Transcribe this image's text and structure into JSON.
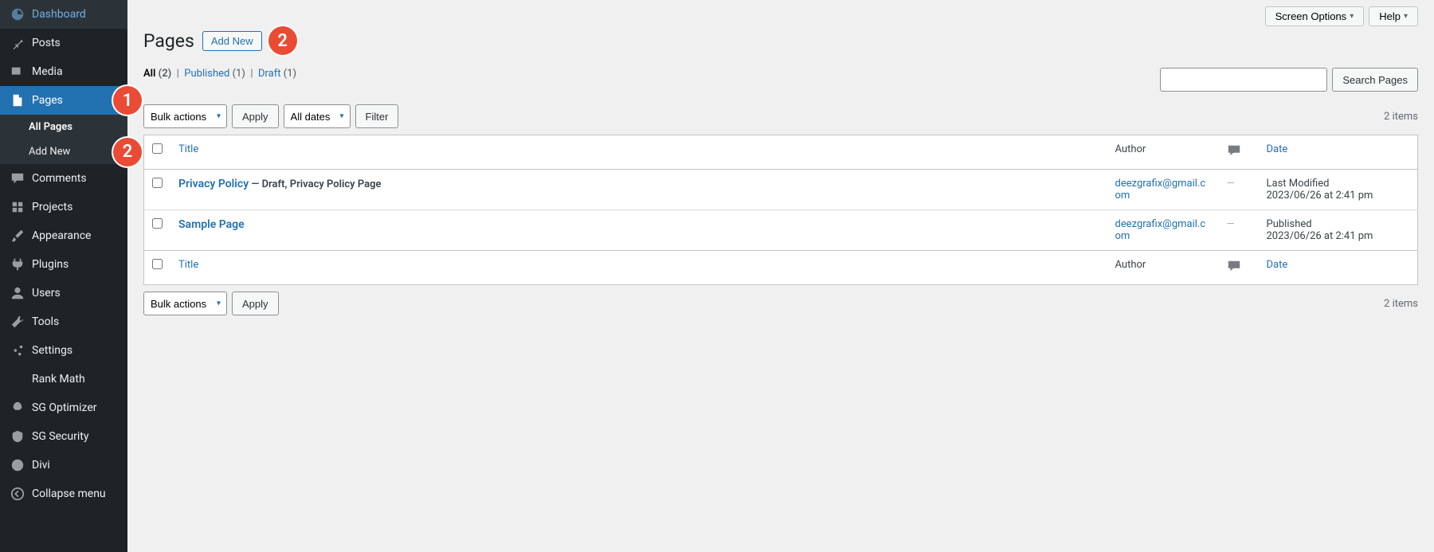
{
  "sidebar": {
    "dashboard": "Dashboard",
    "posts": "Posts",
    "media": "Media",
    "pages": "Pages",
    "all_pages": "All Pages",
    "add_new": "Add New",
    "comments": "Comments",
    "projects": "Projects",
    "appearance": "Appearance",
    "plugins": "Plugins",
    "users": "Users",
    "tools": "Tools",
    "settings": "Settings",
    "rank_math": "Rank Math",
    "sg_optimizer": "SG Optimizer",
    "sg_security": "SG Security",
    "divi": "Divi",
    "collapse": "Collapse menu"
  },
  "annotation_badges": {
    "one": "1",
    "two": "2",
    "three": "2"
  },
  "top": {
    "screen_options": "Screen Options",
    "help": "Help"
  },
  "heading": "Pages",
  "add_new_btn": "Add New",
  "filters": {
    "all_label": "All",
    "all_count": "(2)",
    "sep": "|",
    "published_label": "Published",
    "published_count": "(1)",
    "draft_label": "Draft",
    "draft_count": "(1)"
  },
  "search": {
    "button": "Search Pages"
  },
  "bulk": {
    "label": "Bulk actions",
    "apply": "Apply",
    "dates": "All dates",
    "filter": "Filter"
  },
  "count_text": "2 items",
  "table": {
    "title": "Title",
    "author": "Author",
    "date": "Date",
    "rows": [
      {
        "title": "Privacy Policy",
        "state": " — Draft, Privacy Policy Page",
        "author": "deezgrafix@gmail.com",
        "comments": "—",
        "date_l1": "Last Modified",
        "date_l2": "2023/06/26 at 2:41 pm"
      },
      {
        "title": "Sample Page",
        "state": "",
        "author": "deezgrafix@gmail.com",
        "comments": "—",
        "date_l1": "Published",
        "date_l2": "2023/06/26 at 2:41 pm"
      }
    ]
  }
}
